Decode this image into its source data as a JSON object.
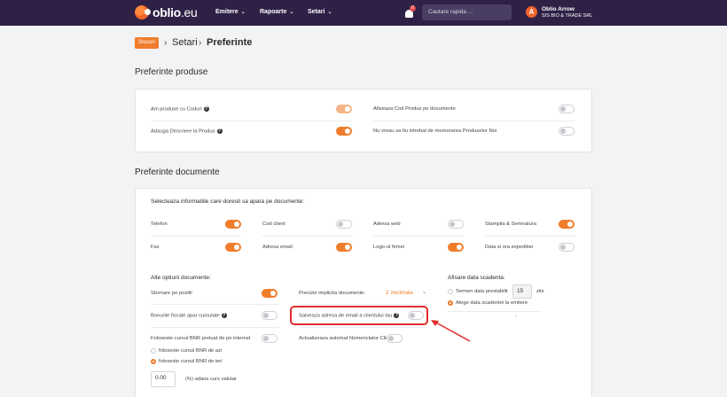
{
  "nav": {
    "brand": "oblio",
    "brand_suffix": ".eu",
    "menu": [
      "Emitere",
      "Rapoarte",
      "Setari"
    ],
    "notification_count": "0",
    "search_placeholder": "Cautare rapida ...",
    "user": {
      "initial": "A",
      "name": "Oblio Arrow",
      "company": "SIS BIO & TRADE SRL"
    }
  },
  "breadcrumb": {
    "badge": "Stocuri",
    "items": [
      "Setari",
      "Preferinte"
    ]
  },
  "produse": {
    "title": "Preferinte produse",
    "rows": [
      {
        "label": "Am produse cu Coduri",
        "help": true,
        "on": true,
        "dim": true
      },
      {
        "label": "Afiseaza Cod Produs pe documente",
        "help": false,
        "on": false
      },
      {
        "label": "Adauga Descriere la Produs",
        "help": true,
        "on": true
      },
      {
        "label": "Nu vreau sa fiu intrebat de memorarea Produselor Noi",
        "help": false,
        "on": false
      }
    ]
  },
  "documente": {
    "title": "Preferinte documente",
    "select_label": "Selecteaza informatiile care doresti sa apara pe documente:",
    "info": [
      {
        "label": "Telefon",
        "on": true
      },
      {
        "label": "Cod client",
        "on": false
      },
      {
        "label": "Adresa web",
        "on": false
      },
      {
        "label": "Stampila & Semnatura",
        "on": true
      },
      {
        "label": "Fax",
        "on": true
      },
      {
        "label": "Adresa email",
        "on": true
      },
      {
        "label": "Logo-ul firmei",
        "on": true
      },
      {
        "label": "Data si ora expeditiei",
        "on": false
      }
    ],
    "alte_title": "Alte optiuni documente:",
    "stornare": {
      "label": "Stornare pe pozitii",
      "on": true
    },
    "bonurile": {
      "label": "Bonurile fiscale apar cumulate",
      "on": false
    },
    "curs": {
      "label": "Foloseste cursul BNR preluat de pe internet",
      "on": false
    },
    "curs_options": [
      {
        "label": "foloseste cursul BNR de azi",
        "selected": false
      },
      {
        "label": "foloseste cursul BNR de ieri",
        "selected": true
      }
    ],
    "adaos_value": "0.00",
    "adaos_label": "(%) adaos curs valutar",
    "precizie": {
      "label": "Precizie implicita documente:",
      "value": "2 zecimale"
    },
    "salveaza": {
      "label": "Salveaza adresa de email a clientului tau",
      "on": false
    },
    "actualizeaza": {
      "label": "Actualizeaza automat Nomenclator Clienti",
      "on": false
    },
    "scadenta_title": "Afisare data scadenta:",
    "scadenta_options": [
      {
        "label": "Termen data prestabilit",
        "selected": false,
        "days": "15",
        "suffix": "zile"
      },
      {
        "label": "Alege data scadentei la emitere",
        "selected": true
      }
    ],
    "dash": "-"
  },
  "colors": {
    "accent": "#f07d2c",
    "nav_bg": "#2f2146",
    "highlight": "#e32b2b"
  }
}
